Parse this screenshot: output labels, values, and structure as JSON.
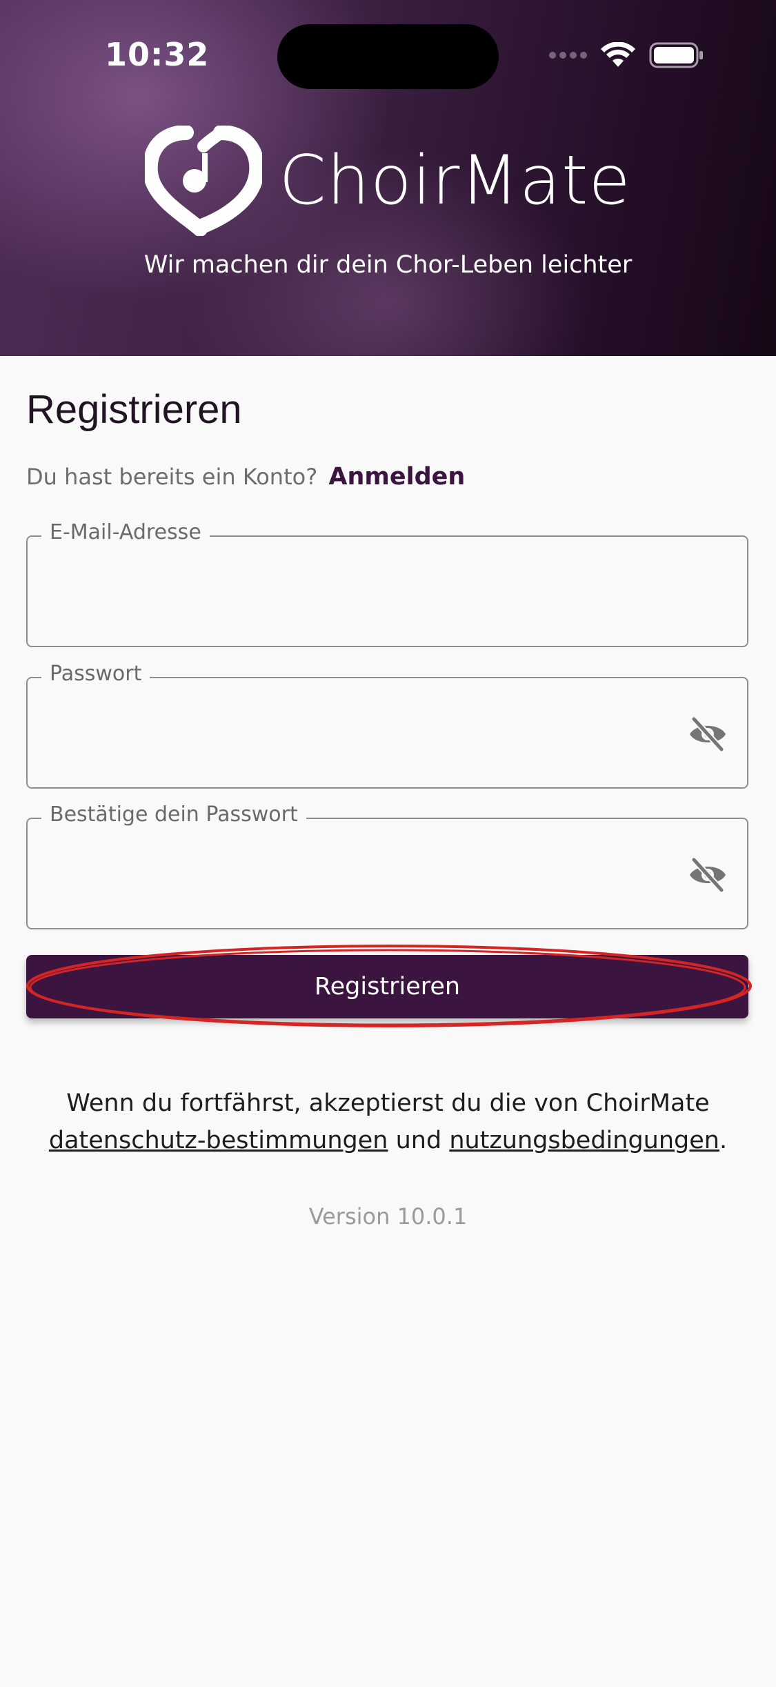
{
  "status_bar": {
    "time": "10:32"
  },
  "header": {
    "brand": "ChoirMate",
    "tagline": "Wir machen dir dein Chor-Leben leichter"
  },
  "form": {
    "title": "Registrieren",
    "login_prompt": "Du hast bereits ein Konto?",
    "login_link": "Anmelden",
    "email_label": "E-Mail-Adresse",
    "email_value": "",
    "password_label": "Passwort",
    "password_value": "",
    "confirm_label": "Bestätige dein Passwort",
    "confirm_value": "",
    "submit_label": "Registrieren"
  },
  "legal": {
    "line1": "Wenn du fortfährst, akzeptierst du die von ChoirMate",
    "privacy_link": "datenschutz-bestimmungen",
    "and": " und ",
    "terms_link": "nutzungsbedingungen",
    "period": "."
  },
  "version": "Version 10.0.1",
  "colors": {
    "primary": "#3b1540",
    "highlight": "#d42525"
  },
  "icons": {
    "password_toggle": "eye-off-icon",
    "logo": "heart-note-icon"
  }
}
